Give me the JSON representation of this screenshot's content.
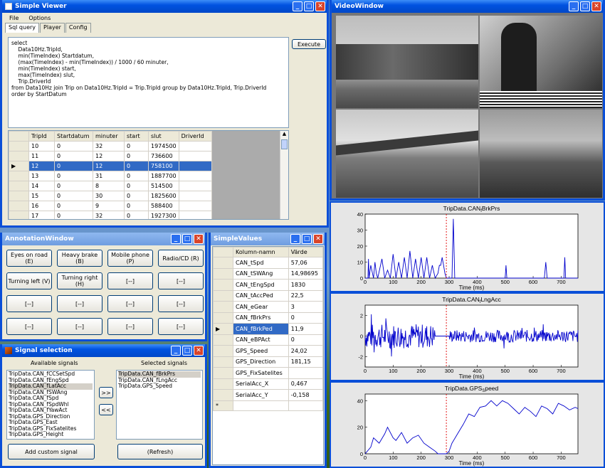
{
  "simple_viewer": {
    "title": "Simple Viewer",
    "menu": [
      "File",
      "Options"
    ],
    "tabs": [
      "Sql query",
      "Player",
      "Config"
    ],
    "query": "select\n    Data10Hz.TripId,\n    min(TimeIndex) Startdatum,\n    (max(TimeIndex) - min(TimeIndex)) / 1000 / 60 minuter,\n    min(TimeIndex) start,\n    max(TimeIndex) slut,\n    Trip.DriverId\nfrom Data10Hz join Trip on Data10Hz.TripId = Trip.TripId group by Data10Hz.TripId, Trip.DriverId\norder by StartDatum",
    "execute_label": "Execute",
    "columns": [
      "TripId",
      "Startdatum",
      "minuter",
      "start",
      "slut",
      "DriverId"
    ],
    "rows": [
      [
        "10",
        "0",
        "32",
        "0",
        "1974500",
        ""
      ],
      [
        "11",
        "0",
        "12",
        "0",
        "736600",
        ""
      ],
      [
        "12",
        "0",
        "12",
        "0",
        "758100",
        ""
      ],
      [
        "13",
        "0",
        "31",
        "0",
        "1887700",
        ""
      ],
      [
        "14",
        "0",
        "8",
        "0",
        "514500",
        ""
      ],
      [
        "15",
        "0",
        "30",
        "0",
        "1825600",
        ""
      ],
      [
        "16",
        "0",
        "9",
        "0",
        "588400",
        ""
      ],
      [
        "17",
        "0",
        "32",
        "0",
        "1927300",
        ""
      ]
    ],
    "selected_row": 2
  },
  "video_window": {
    "title": "VideoWindow"
  },
  "annotation_window": {
    "title": "AnnotationWindow",
    "buttons": [
      "Eyes on road (E)",
      "Heavy brake (B)",
      "Mobile phone (P)",
      "Radio/CD (R)",
      "Turning left (V)",
      "Turning right (H)",
      "[--]",
      "[--]",
      "[--]",
      "[--]",
      "[--]",
      "[--]",
      "[--]",
      "[--]",
      "[--]",
      "[--]"
    ]
  },
  "simple_values": {
    "title": "SimpleValues",
    "col_name": "Kolumn-namn",
    "col_value": "Värde",
    "rows": [
      [
        "CAN_tSpd",
        "57,06"
      ],
      [
        "CAN_tSWAng",
        "14,98695"
      ],
      [
        "CAN_tEngSpd",
        "1830"
      ],
      [
        "CAN_tAccPed",
        "22,5"
      ],
      [
        "CAN_eGear",
        "3"
      ],
      [
        "CAN_fBrkPrs",
        "0"
      ],
      [
        "CAN_fBrkPed",
        "11,9"
      ],
      [
        "CAN_eBPAct",
        "0"
      ],
      [
        "GPS_Speed",
        "24,02"
      ],
      [
        "GPS_Direction",
        "181,15"
      ],
      [
        "GPS_FixSatelites",
        ""
      ],
      [
        "SerialAcc_X",
        "0,467"
      ],
      [
        "SerialAcc_Y",
        "-0,158"
      ]
    ],
    "selected_row": 6,
    "new_row_marker": "*"
  },
  "signal_selection": {
    "title": "Signal selection",
    "available_label": "Available signals",
    "selected_label": "Selected signals",
    "available": [
      "TripData.CAN_fCCSetSpd",
      "TripData.CAN_fEngSpd",
      "TripData.CAN_fLatAcc",
      "TripData.CAN_fSWAng",
      "TripData.CAN_fSpd",
      "TripData.CAN_fSpdWhl",
      "TripData.CAN_fYawAct",
      "TripData.GPS_Direction",
      "TripData.GPS_East",
      "TripData.GPS_FixSatelites",
      "TripData.GPS_Height"
    ],
    "available_highlight": 2,
    "selected": [
      "TripData.CAN_fBrkPrs",
      "TripData.CAN_fLngAcc",
      "TripData.GPS_Speed"
    ],
    "add_label": ">>",
    "remove_label": "<<",
    "add_custom_label": "Add custom signal",
    "refresh_label": "(Refresh)"
  },
  "chart_data": [
    {
      "type": "line",
      "title": "TripData.CAN",
      "title_subscript": "f",
      "title_rest": "BrkPrs",
      "xlabel": "Time (ms)",
      "xlim": [
        0,
        760
      ],
      "ylim": [
        0,
        40
      ],
      "xticks": [
        0,
        100,
        200,
        300,
        400,
        500,
        600,
        700
      ],
      "yticks": [
        0,
        10,
        20,
        30,
        40
      ],
      "cursor_x": 290,
      "series": [
        {
          "color": "#0000cc",
          "x": [
            0,
            10,
            12,
            14,
            20,
            30,
            35,
            40,
            45,
            60,
            70,
            80,
            90,
            100,
            110,
            120,
            130,
            140,
            150,
            160,
            170,
            180,
            190,
            200,
            210,
            220,
            230,
            240,
            250,
            260,
            265,
            270,
            275,
            280,
            285,
            290,
            300,
            310,
            315,
            320,
            330,
            340,
            400,
            450,
            500,
            503,
            506,
            510,
            600,
            640,
            645,
            650,
            700,
            710,
            713,
            716,
            720,
            760
          ],
          "y": [
            0,
            0,
            12,
            0,
            8,
            0,
            10,
            3,
            0,
            12,
            0,
            5,
            0,
            15,
            0,
            10,
            0,
            13,
            0,
            17,
            0,
            12,
            0,
            13,
            0,
            13,
            0,
            8,
            0,
            3,
            8,
            8,
            13,
            8,
            3,
            0,
            0,
            0,
            37,
            0,
            0,
            0,
            0,
            0,
            0,
            8,
            0,
            0,
            0,
            0,
            10,
            0,
            0,
            0,
            13,
            0,
            0,
            0
          ]
        }
      ]
    },
    {
      "type": "line",
      "title": "TripData.CAN",
      "title_subscript": "f",
      "title_rest": "LngAcc",
      "xlabel": "Time (ms)",
      "xlim": [
        0,
        760
      ],
      "ylim": [
        -3,
        3
      ],
      "xticks": [
        0,
        100,
        200,
        300,
        400,
        500,
        600,
        700
      ],
      "yticks": [
        -2,
        0,
        2
      ],
      "cursor_x": 290,
      "series": [
        {
          "color": "#0000cc",
          "noisy": true,
          "amp_left": 1.2,
          "amp_right": 0.6,
          "flat_from": 250,
          "flat_to": 300
        }
      ]
    },
    {
      "type": "line",
      "title": "TripData.GPS",
      "title_subscript": "S",
      "title_rest": "peed",
      "xlabel": "Time (ms)",
      "xlim": [
        0,
        760
      ],
      "ylim": [
        0,
        45
      ],
      "xticks": [
        0,
        100,
        200,
        300,
        400,
        500,
        600,
        700
      ],
      "yticks": [
        0,
        20,
        40
      ],
      "cursor_x": 290,
      "series": [
        {
          "color": "#0000cc",
          "x": [
            0,
            20,
            30,
            50,
            70,
            80,
            100,
            110,
            130,
            150,
            170,
            190,
            210,
            230,
            250,
            260,
            270,
            280,
            290,
            300,
            310,
            330,
            350,
            370,
            390,
            410,
            430,
            450,
            470,
            490,
            510,
            530,
            550,
            570,
            590,
            610,
            630,
            650,
            670,
            690,
            710,
            730,
            750,
            760
          ],
          "y": [
            0,
            5,
            12,
            8,
            15,
            20,
            12,
            10,
            16,
            8,
            12,
            14,
            8,
            5,
            2,
            0,
            0,
            0,
            0,
            2,
            8,
            15,
            22,
            30,
            28,
            35,
            36,
            40,
            36,
            40,
            38,
            34,
            30,
            35,
            32,
            28,
            36,
            34,
            30,
            38,
            36,
            33,
            35,
            34
          ]
        }
      ]
    }
  ]
}
